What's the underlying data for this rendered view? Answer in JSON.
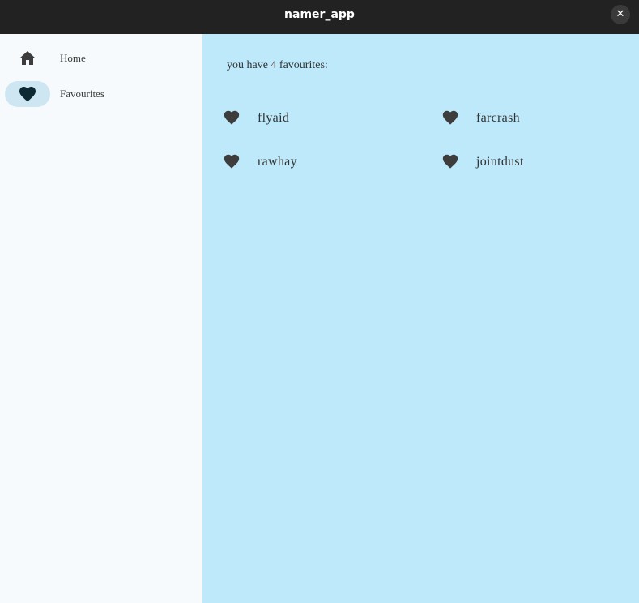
{
  "window": {
    "title": "namer_app",
    "close_glyph": "✕"
  },
  "sidebar": {
    "items": [
      {
        "label": "Home",
        "icon": "home-icon",
        "selected": false
      },
      {
        "label": "Favourites",
        "icon": "heart-icon",
        "selected": true
      }
    ]
  },
  "favourites": {
    "count_text": "you have 4 favourites:",
    "items": [
      "flyaid",
      "farcrash",
      "rawhay",
      "jointdust"
    ]
  },
  "colors": {
    "titlebar": "#222222",
    "sidebar_bg": "#f6fafc",
    "main_bg": "#bde9fb",
    "selected_pill": "#cde6f2",
    "icon": "#3d3d3d",
    "selected_icon": "#0d2a33"
  }
}
